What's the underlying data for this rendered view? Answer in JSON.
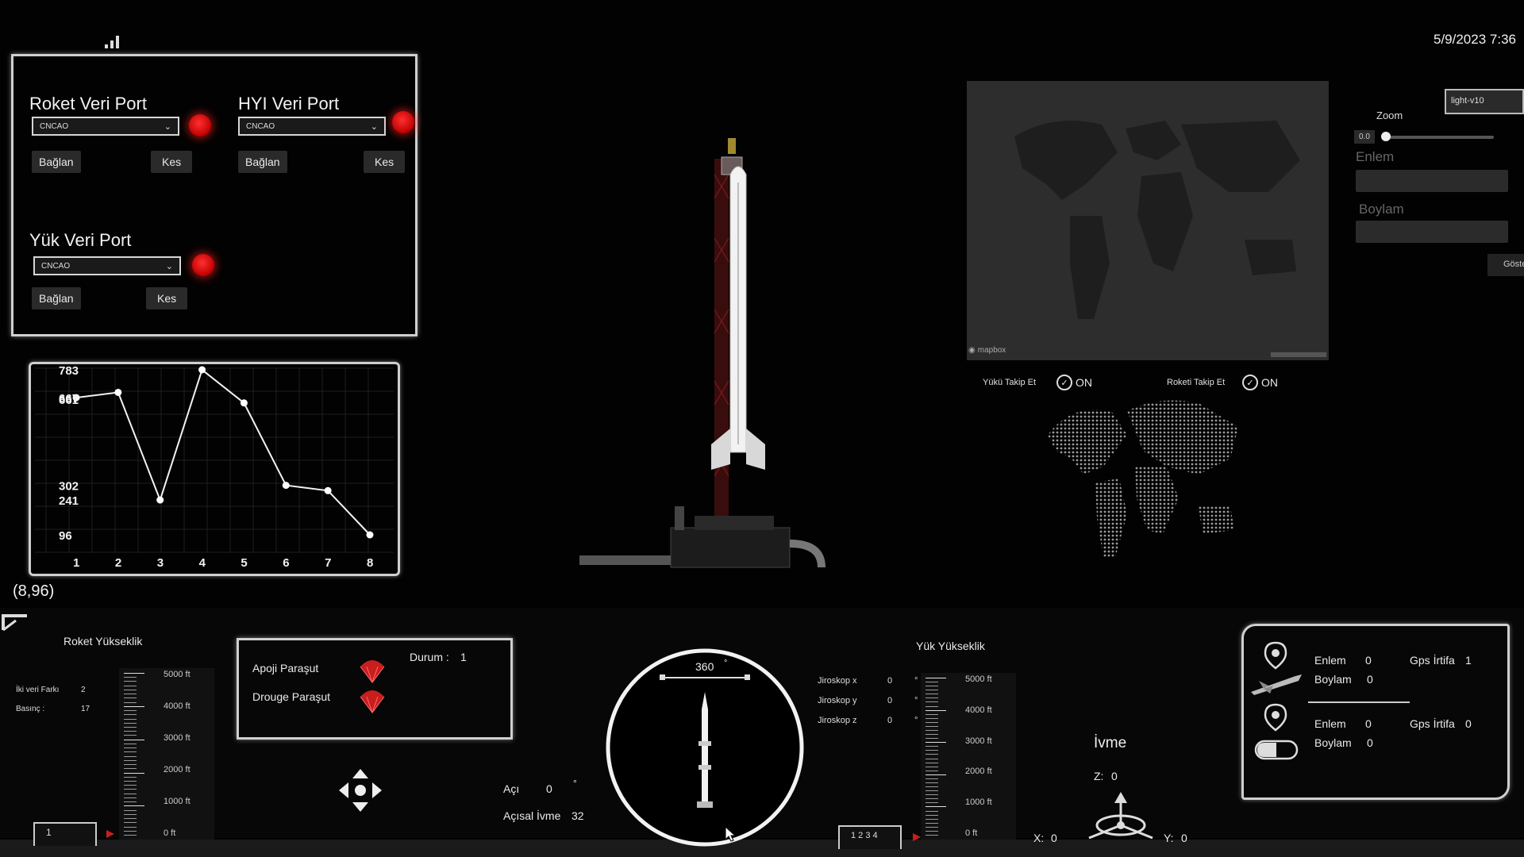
{
  "header": {
    "datetime": "5/9/2023 7:36"
  },
  "ports": {
    "rocket": {
      "title": "Roket Veri Port",
      "selected": "CNCAO",
      "connect": "Bağlan",
      "disconnect": "Kes"
    },
    "hyi": {
      "title": "HYI Veri Port",
      "selected": "CNCAO",
      "connect": "Bağlan",
      "disconnect": "Kes"
    },
    "payload": {
      "title": "Yük Veri Port",
      "selected": "CNCAO",
      "connect": "Bağlan",
      "disconnect": "Kes"
    }
  },
  "chart_data": {
    "type": "line",
    "x": [
      1,
      2,
      3,
      4,
      5,
      6,
      7,
      8
    ],
    "values": [
      667,
      689,
      241,
      783,
      645,
      302,
      280,
      96
    ],
    "y_tick_labels": [
      "783",
      "667",
      "661",
      "302",
      "241",
      "96"
    ],
    "x_tick_labels": [
      "1",
      "2",
      "3",
      "4",
      "5",
      "6",
      "7",
      "8"
    ],
    "ylim": [
      96,
      783
    ],
    "grid": true,
    "point_readout": "(8,96)"
  },
  "map": {
    "style": "light-v10",
    "zoom_label": "Zoom",
    "zoom_value": "0.0",
    "lat_label": "Enlem",
    "lon_label": "Boylam",
    "show_button": "Göster",
    "attribution": "mapbox"
  },
  "tracking": {
    "payload_label": "Yükü Takip Et",
    "payload_state": "ON",
    "rocket_label": "Roketi Takip Et",
    "rocket_state": "ON"
  },
  "rocket_altitude": {
    "title": "Roket Yükseklik",
    "diff_label": "İki veri Farkı",
    "diff_value": "2",
    "pressure_label": "Basınç :",
    "pressure_value": "17",
    "scale": [
      "5000 ft",
      "4000 ft",
      "3000 ft",
      "2000 ft",
      "1000 ft",
      "0 ft"
    ],
    "readout": "1"
  },
  "parachutes": {
    "apogee": "Apoji Paraşut",
    "drogue": "Drouge Paraşut",
    "status_label": "Durum :",
    "status_value": "1"
  },
  "orientation": {
    "heading": "360",
    "heading_unit": "°",
    "angle_label": "Açı",
    "angle_value": "0",
    "angle_unit": "°",
    "angular_accel_label": "Açısal İvme",
    "angular_accel_value": "32"
  },
  "gyro": [
    {
      "label": "Jiroskop x",
      "value": "0",
      "unit": "°"
    },
    {
      "label": "Jiroskop y",
      "value": "0",
      "unit": "°"
    },
    {
      "label": "Jiroskop z",
      "value": "0",
      "unit": "°"
    }
  ],
  "payload_altitude": {
    "title": "Yük Yükseklik",
    "scale": [
      "5000 ft",
      "4000 ft",
      "3000 ft",
      "2000 ft",
      "1000 ft",
      "0 ft"
    ],
    "readout": "1 2 3 4"
  },
  "acceleration": {
    "title": "İvme",
    "z_label": "Z:",
    "z_value": "0",
    "x_label": "X:",
    "x_value": "0",
    "y_label": "Y:",
    "y_value": "0"
  },
  "gps": {
    "rocket": {
      "lat_label": "Enlem",
      "lat_value": "0",
      "lon_label": "Boylam",
      "lon_value": "0",
      "alt_label": "Gps İrtifa",
      "alt_value": "1"
    },
    "payload": {
      "lat_label": "Enlem",
      "lat_value": "0",
      "lon_label": "Boylam",
      "lon_value": "0",
      "alt_label": "Gps İrtifa",
      "alt_value": "0"
    }
  },
  "colors": {
    "led": "#ff2020",
    "accent": "#c81e1e",
    "frame": "#cfcfcf"
  }
}
